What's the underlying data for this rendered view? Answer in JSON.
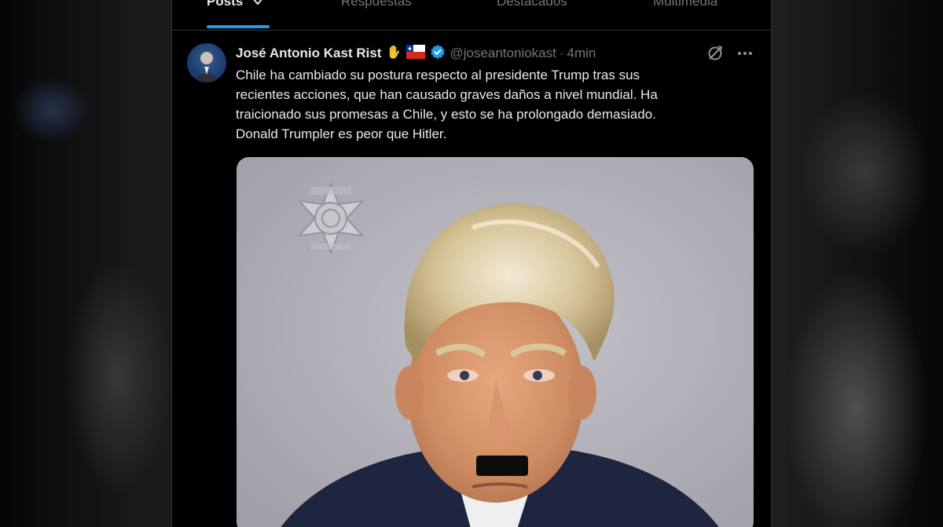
{
  "tabs": [
    {
      "label": "Posts",
      "active": true
    },
    {
      "label": "Respuestas",
      "active": false
    },
    {
      "label": "Destacados",
      "active": false
    },
    {
      "label": "Multimedia",
      "active": false
    }
  ],
  "post": {
    "display_name": "José Antonio Kast Rist",
    "handle": "@joseantoniokast",
    "separator": "·",
    "time": "4min",
    "emojis": [
      "raised-hand",
      "chile-flag"
    ],
    "verified": true,
    "text_lines": [
      "Chile ha cambiado su postura respecto al presidente Trump tras sus",
      "recientes acciones, que han causado graves daños a nivel mundial. Ha",
      "traicionado sus promesas a Chile, y esto se ha prolongado demasiado.",
      "Donald Trumpler es peor que Hitler."
    ],
    "media": {
      "description_icon": "mugshot-photo",
      "badge_icon": "sheriff-star-badge"
    }
  },
  "colors": {
    "accent": "#1d9bf0",
    "background": "#000000",
    "text": "#e7e9ea",
    "muted": "#71767b",
    "border": "#2f3336"
  },
  "icons": {
    "tab_chevron": "chevron-down-icon",
    "grok": "grok-icon",
    "more": "more-icon",
    "verified": "verified-badge-icon"
  }
}
